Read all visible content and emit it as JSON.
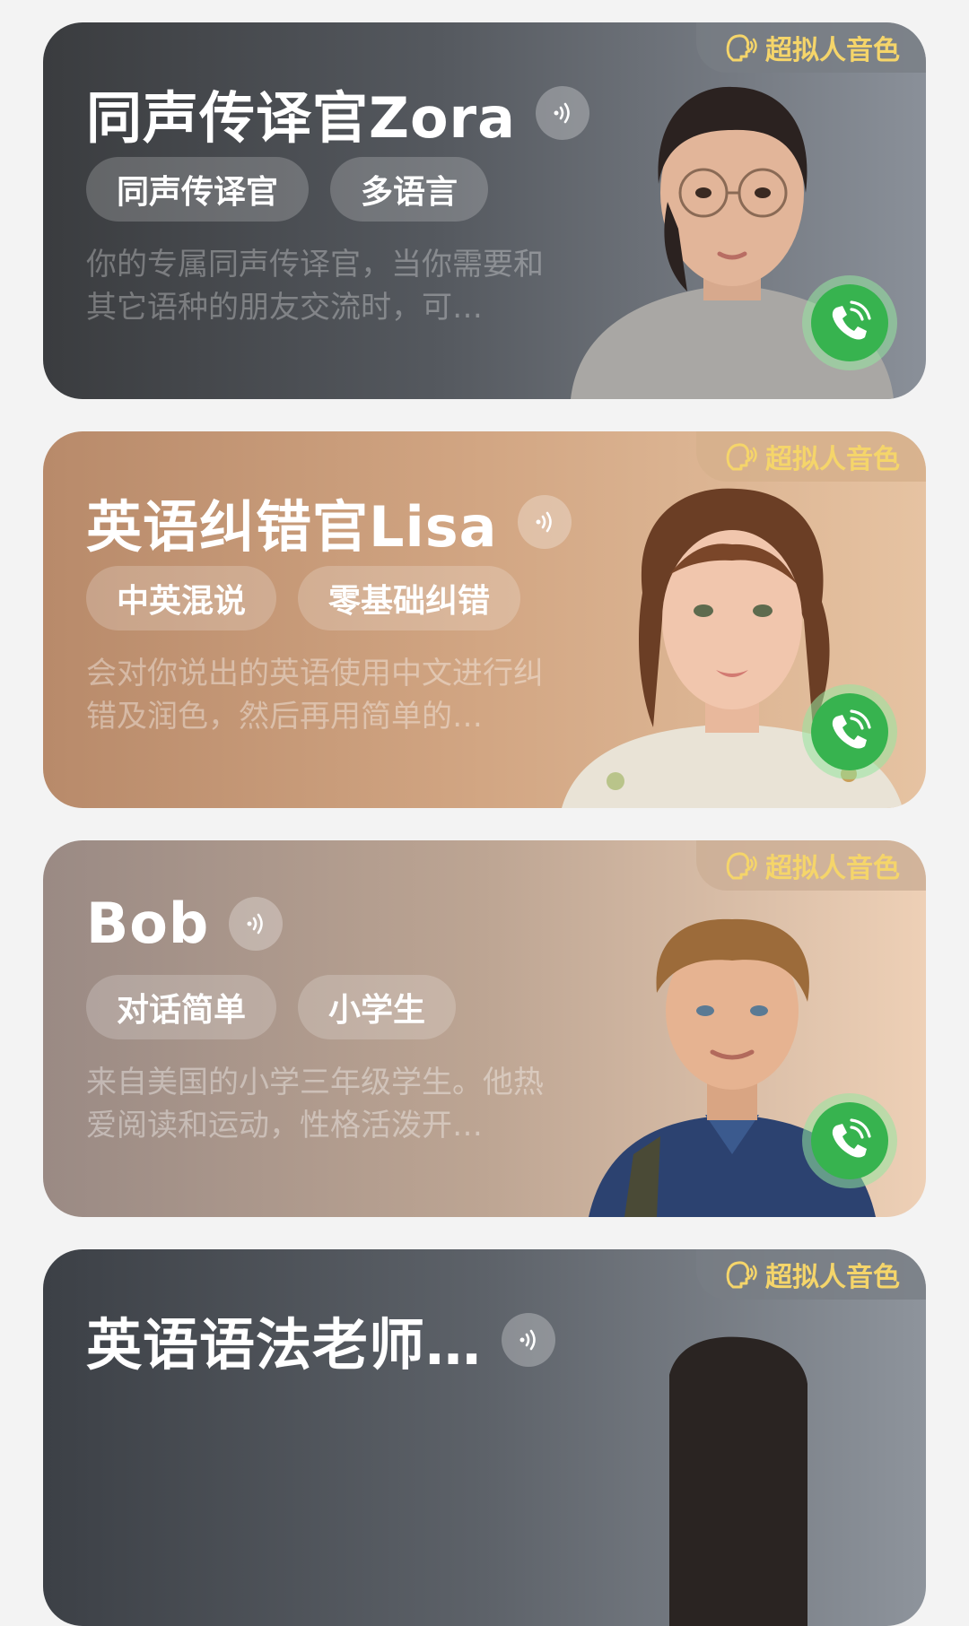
{
  "colors": {
    "badge_text": "#f5d56a",
    "call_button": "#37b34f",
    "page_background": "#f3f3f3"
  },
  "cards": [
    {
      "title": "同声传译官Zora",
      "badge": "超拟人音色",
      "tags": [
        "同声传译官",
        "多语言"
      ],
      "description": "你的专属同声传译官，当你需要和其它语种的朋友交流时，可…",
      "portrait_icon": "woman-with-glasses-portrait"
    },
    {
      "title": "英语纠错官Lisa",
      "badge": "超拟人音色",
      "tags": [
        "中英混说",
        "零基础纠错"
      ],
      "description": "会对你说出的英语使用中文进行纠错及润色，然后再用简单的…",
      "portrait_icon": "young-woman-portrait"
    },
    {
      "title": "Bob",
      "badge": "超拟人音色",
      "tags": [
        "对话简单",
        "小学生"
      ],
      "description": "来自美国的小学三年级学生。他热爱阅读和运动，性格活泼开…",
      "portrait_icon": "boy-portrait"
    },
    {
      "title": "英语语法老师…",
      "badge": "超拟人音色",
      "tags": [],
      "description": "",
      "portrait_icon": "person-portrait"
    }
  ]
}
